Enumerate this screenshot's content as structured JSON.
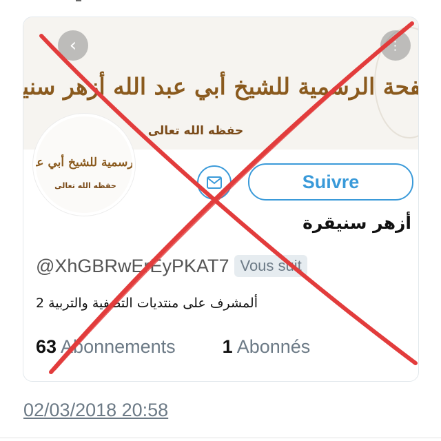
{
  "banner": {
    "calligraphy_line1": "الصفحة الرسمية للشيخ أبي عبد الله أزهر سنيقرة",
    "calligraphy_line2": "حفظه الله تعالى",
    "back_icon": "chevron-left-icon",
    "more_icon": "more-dots-icon"
  },
  "avatar": {
    "line1": "الرسمية للشيخ أبي عبد",
    "line2": "حفظه الله تعالى"
  },
  "actions": {
    "message_icon": "envelope-icon",
    "follow_label": "Suivre"
  },
  "profile": {
    "display_name": "أزهر سنيقرة",
    "handle": "@XhGBRwErEyPKAT7",
    "follows_you_badge": "Vous suit",
    "bio": "ألمشرف على منتديات التصفية والتربية 2"
  },
  "stats": {
    "following_count": "63",
    "following_label": "Abonnements",
    "followers_count": "1",
    "followers_label": "Abonnés"
  },
  "timestamp": "02/03/2018 20:58",
  "colors": {
    "accent": "#3a9ad9",
    "cross": "#e23c3c",
    "calligraphy": "#8a5a1e"
  }
}
